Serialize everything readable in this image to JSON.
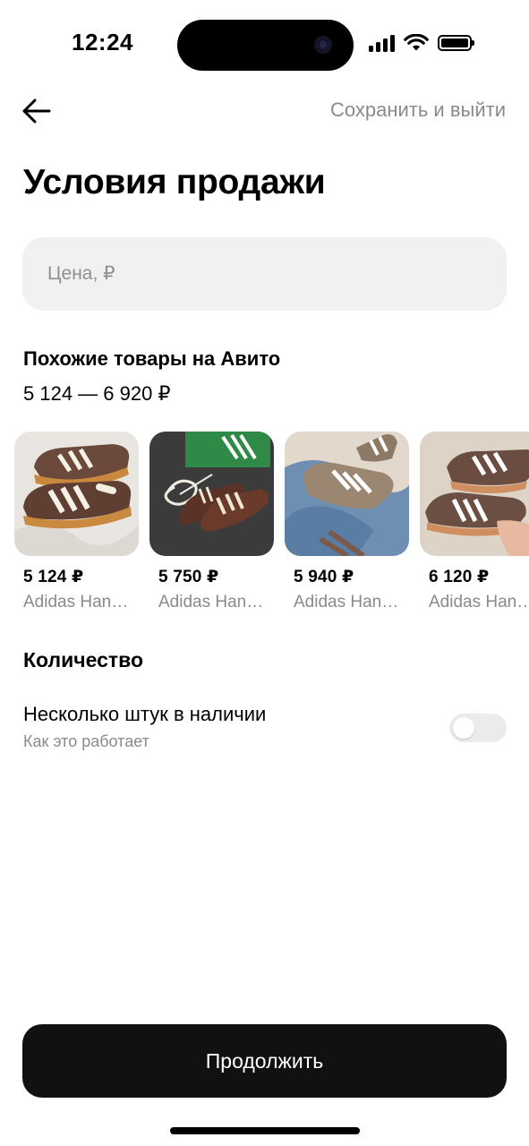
{
  "status_bar": {
    "time": "12:24"
  },
  "header": {
    "save_exit": "Сохранить и выйти"
  },
  "page": {
    "title": "Условия продажи"
  },
  "price_field": {
    "placeholder": "Цена, ₽",
    "value": ""
  },
  "similar": {
    "title": "Похожие товары на Авито",
    "range": "5 124 — 6 920 ₽",
    "items": [
      {
        "price": "5 124 ₽",
        "name": "Adidas Handball Spezial"
      },
      {
        "price": "5 750 ₽",
        "name": "Adidas Handball Spezial"
      },
      {
        "price": "5 940 ₽",
        "name": "Adidas Handball Spezial"
      },
      {
        "price": "6 120 ₽",
        "name": "Adidas Handball Spezial"
      }
    ]
  },
  "quantity": {
    "title": "Количество",
    "multiple_label": "Несколько штук в наличии",
    "how_it_works": "Как это работает",
    "multiple_enabled": false
  },
  "footer": {
    "continue_label": "Продолжить"
  },
  "colors": {
    "button_bg": "#111111",
    "field_bg": "#f2f1ef",
    "muted_text": "#8a8a8a"
  }
}
